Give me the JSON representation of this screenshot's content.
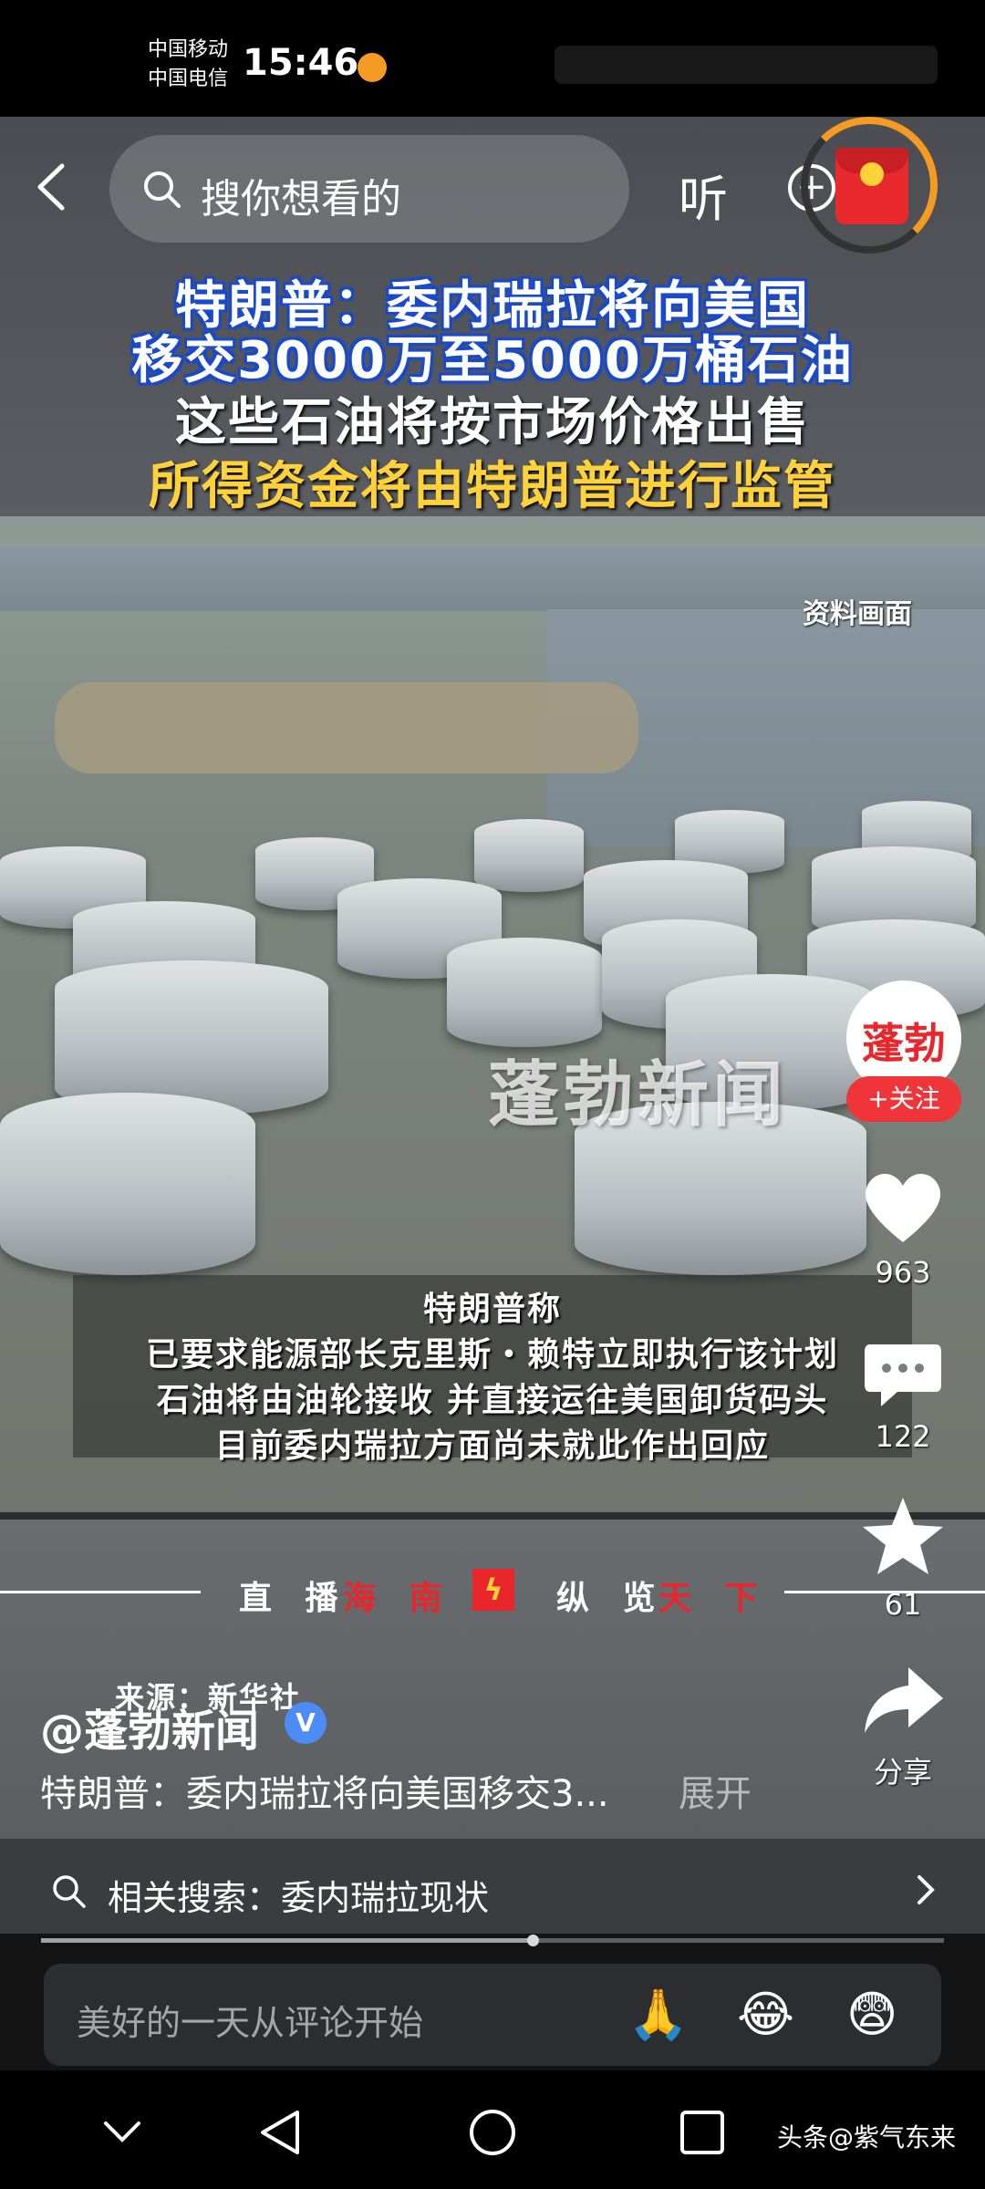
{
  "status_bar": {
    "carrier_1": "中国移动",
    "carrier_2": "中国电信",
    "time": "15:46"
  },
  "top_bar": {
    "search_placeholder": "搜你想看的",
    "listen_label": "听"
  },
  "video": {
    "headline": [
      "特朗普：委内瑞拉将向美国",
      "移交3000万至5000万桶石油",
      "这些石油将按市场价格出售",
      "所得资金将由特朗普进行监管"
    ],
    "footage_tag": "资料画面",
    "watermark": "蓬勃新闻",
    "caption": [
      "特朗普称",
      "已要求能源部长克里斯・赖特立即执行该计划",
      "石油将由油轮接收 并直接运往美国卸货码头",
      "目前委内瑞拉方面尚未就此作出回应"
    ],
    "ribbon": {
      "part_1": "直 播",
      "part_2": "海 南",
      "part_3": "纵 览",
      "part_4": "天 下"
    },
    "source": "来源：新华社"
  },
  "author": {
    "avatar_text": "蓬勃",
    "follow_label": "+关注",
    "handle": "@蓬勃新闻"
  },
  "actions": {
    "likes": "963",
    "comments": "122",
    "favorites": "61",
    "share_label": "分享"
  },
  "description": {
    "text": "特朗普：委内瑞拉将向美国移交3...",
    "expand_label": "展开"
  },
  "related_search": {
    "label": "相关搜索：委内瑞拉现状"
  },
  "comment_input": {
    "placeholder": "美好的一天从评论开始",
    "emojis": [
      "🙏",
      "😂",
      "😨"
    ]
  },
  "watermark_app": "头条@紫气东来",
  "colors": {
    "follow_red": "#f0353a",
    "headline_blue": "#1948c8",
    "headline_yellow": "#ffd23a",
    "ribbon_red": "#e8262b"
  }
}
